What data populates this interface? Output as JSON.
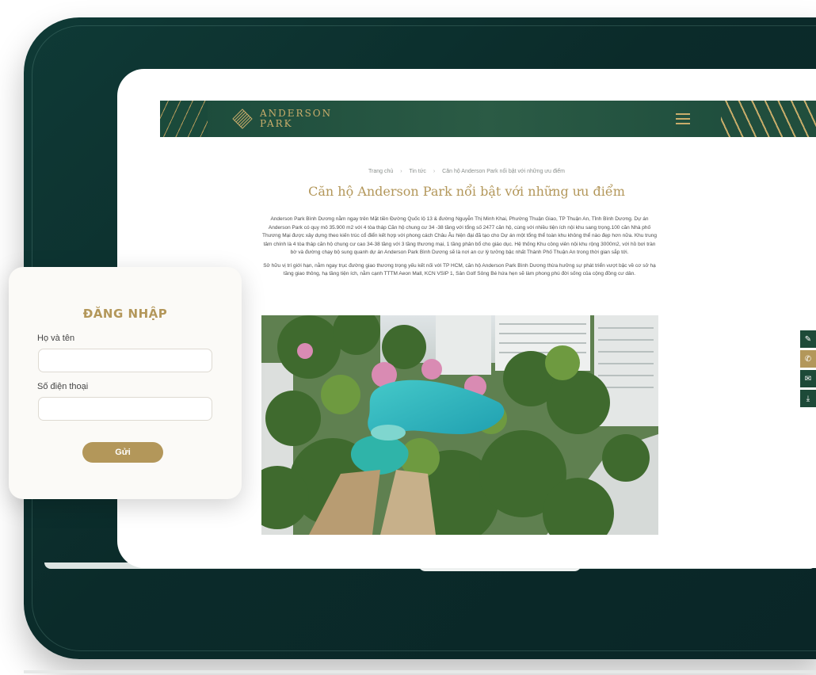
{
  "site": {
    "brand_line1": "ANDERSON",
    "brand_line2": "PARK",
    "breadcrumb": [
      "Trang chủ",
      "Tin tức",
      "Căn hộ Anderson Park nổi bật với những ưu điểm"
    ],
    "title": "Căn hộ Anderson Park nổi bật với những ưu điểm",
    "paragraphs": [
      "Anderson Park Bình Dương nằm ngay trên Mặt tiền Đường Quốc lộ 13 & đường Nguyễn Thị Minh Khai, Phường Thuận Giao, TP Thuận An, Tỉnh Bình Dương. Dự án Anderson Park có quy mô 35.900 m2 với 4 tòa tháp Căn hộ chung cư 34 -38 tầng với tổng số 2477 căn hộ, cùng với nhiều tiện ích nội khu sang trọng.100 căn Nhà phố Thương Mại được xây dựng theo kiến trúc cổ điển kết hợp với phong cách Châu Âu hiện đại đã tạo cho Dự án một tổng thể toàn khu không thể nào đẹp hơn nữa. Khu trung tâm chính là 4 tòa tháp căn hộ chung cư cao 34-38 tầng với 3 tầng thương mại, 1 tầng phân bổ cho giáo dục. Hệ thống Khu công viên nội khu rộng 3000m2, với hồ bơi tràn bờ và đường chạy bộ sung quanh dự án Anderson Park Bình Dương sẽ là nơi an cư lý tưởng bậc nhất Thành Phố Thuận An trong thời gian sắp tới.",
      "Sở hữu vị trí giới hạn, nằm ngay trục đường giao thương trọng yếu kết nối với TP HCM, căn hộ Anderson Park Bình Dương thừa hưởng sự phát triển vượt bậc về cơ sở hạ tầng giao thông, hạ tầng tiện ích, nằm cạnh TTTM Aeon Mall, KCN VSIP 1, Sân Golf Sông Bé hứa hẹn sẽ làm phong phú đời sống của cộng đồng cư dân."
    ],
    "image": "resort-pool-aerial-render",
    "side_actions": [
      "edit-icon",
      "phone-icon",
      "mail-icon",
      "download-icon"
    ]
  },
  "login": {
    "title": "ĐĂNG NHẬP",
    "name_label": "Họ và tên",
    "name_value": "",
    "phone_label": "Số điện thoại",
    "phone_value": "",
    "submit_label": "Gửi"
  },
  "colors": {
    "brand_gold": "#b3975a",
    "brand_green": "#1b4a3b",
    "laptop_frame": "#0b2b2a"
  }
}
